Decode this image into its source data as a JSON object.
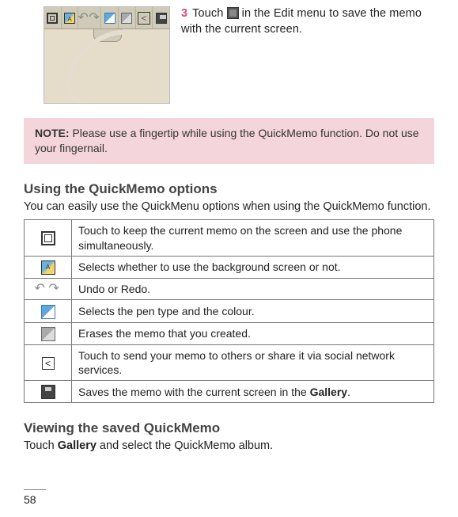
{
  "step": {
    "number": "3",
    "text_before": "Touch ",
    "text_after": " in the Edit menu to save the memo with the current screen."
  },
  "note": {
    "label": "NOTE:",
    "text": " Please use a fingertip while using the QuickMemo function. Do not use your fingernail."
  },
  "section1": {
    "heading": "Using the QuickMemo options",
    "intro": "You can easily use the QuickMenu options when using the QuickMemo function."
  },
  "options": [
    {
      "desc": "Touch to keep the current memo on the screen and use the phone simultaneously."
    },
    {
      "desc": "Selects whether to use the background screen or not."
    },
    {
      "desc": "Undo or Redo."
    },
    {
      "desc": "Selects the pen type and the colour."
    },
    {
      "desc": "Erases the memo that you created."
    },
    {
      "desc": "Touch to send your memo to others or share it via social network services."
    },
    {
      "desc_before": "Saves the memo with the current screen in the ",
      "bold": "Gallery",
      "desc_after": "."
    }
  ],
  "section2": {
    "heading": "Viewing the saved QuickMemo",
    "text_before": "Touch ",
    "bold": "Gallery",
    "text_after": " and select the QuickMemo album."
  },
  "page_number": "58"
}
